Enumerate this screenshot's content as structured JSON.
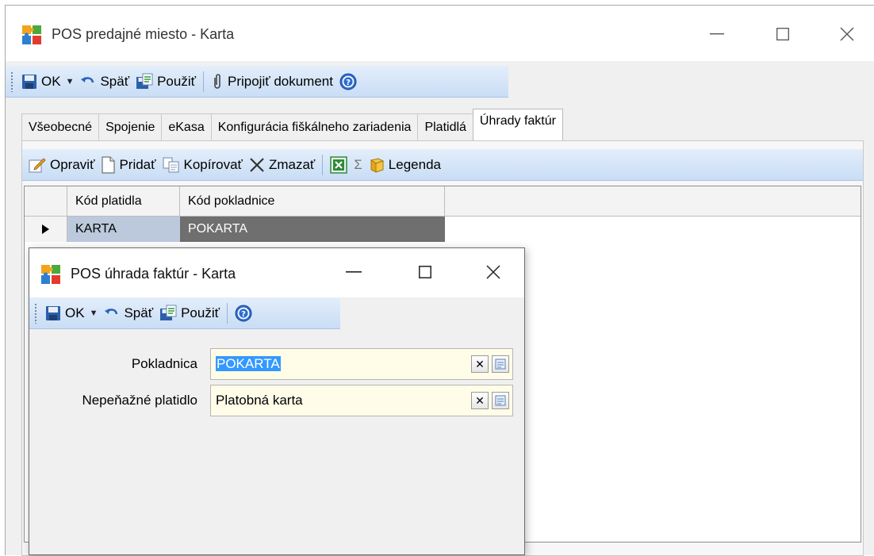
{
  "main_window": {
    "title": "POS predajné miesto - Karta",
    "toolbar": {
      "ok": "OK",
      "back": "Späť",
      "apply": "Použiť",
      "attach": "Pripojiť dokument"
    },
    "tabs": [
      {
        "label": "Všeobecné"
      },
      {
        "label": "Spojenie"
      },
      {
        "label": "eKasa"
      },
      {
        "label": "Konfigurácia fiškálneho zariadenia"
      },
      {
        "label": "Platidlá"
      },
      {
        "label": "Úhrady faktúr"
      }
    ],
    "active_tab": "Úhrady faktúr",
    "list_toolbar": {
      "edit": "Opraviť",
      "add": "Pridať",
      "copy": "Kopírovať",
      "delete": "Zmazať",
      "sum": "Σ",
      "legend": "Legenda"
    },
    "grid": {
      "columns": [
        "Kód platidla",
        "Kód pokladnice"
      ],
      "rows": [
        {
          "kod_platidla": "KARTA",
          "kod_pokladnice": "POKARTA"
        }
      ]
    }
  },
  "dialog": {
    "title": "POS úhrada faktúr - Karta",
    "toolbar": {
      "ok": "OK",
      "back": "Späť",
      "apply": "Použiť"
    },
    "fields": [
      {
        "label": "Pokladnica",
        "value": "POKARTA"
      },
      {
        "label": "Nepeňažné platidlo",
        "value": "Platobná karta"
      }
    ]
  },
  "colors": {
    "toolbar_bg": "#c9ddf5",
    "field_bg": "#fffde8",
    "selection": "#3399ff",
    "row_selected": "#bcc9dc",
    "row_cell_dark": "#6f6f6f"
  }
}
